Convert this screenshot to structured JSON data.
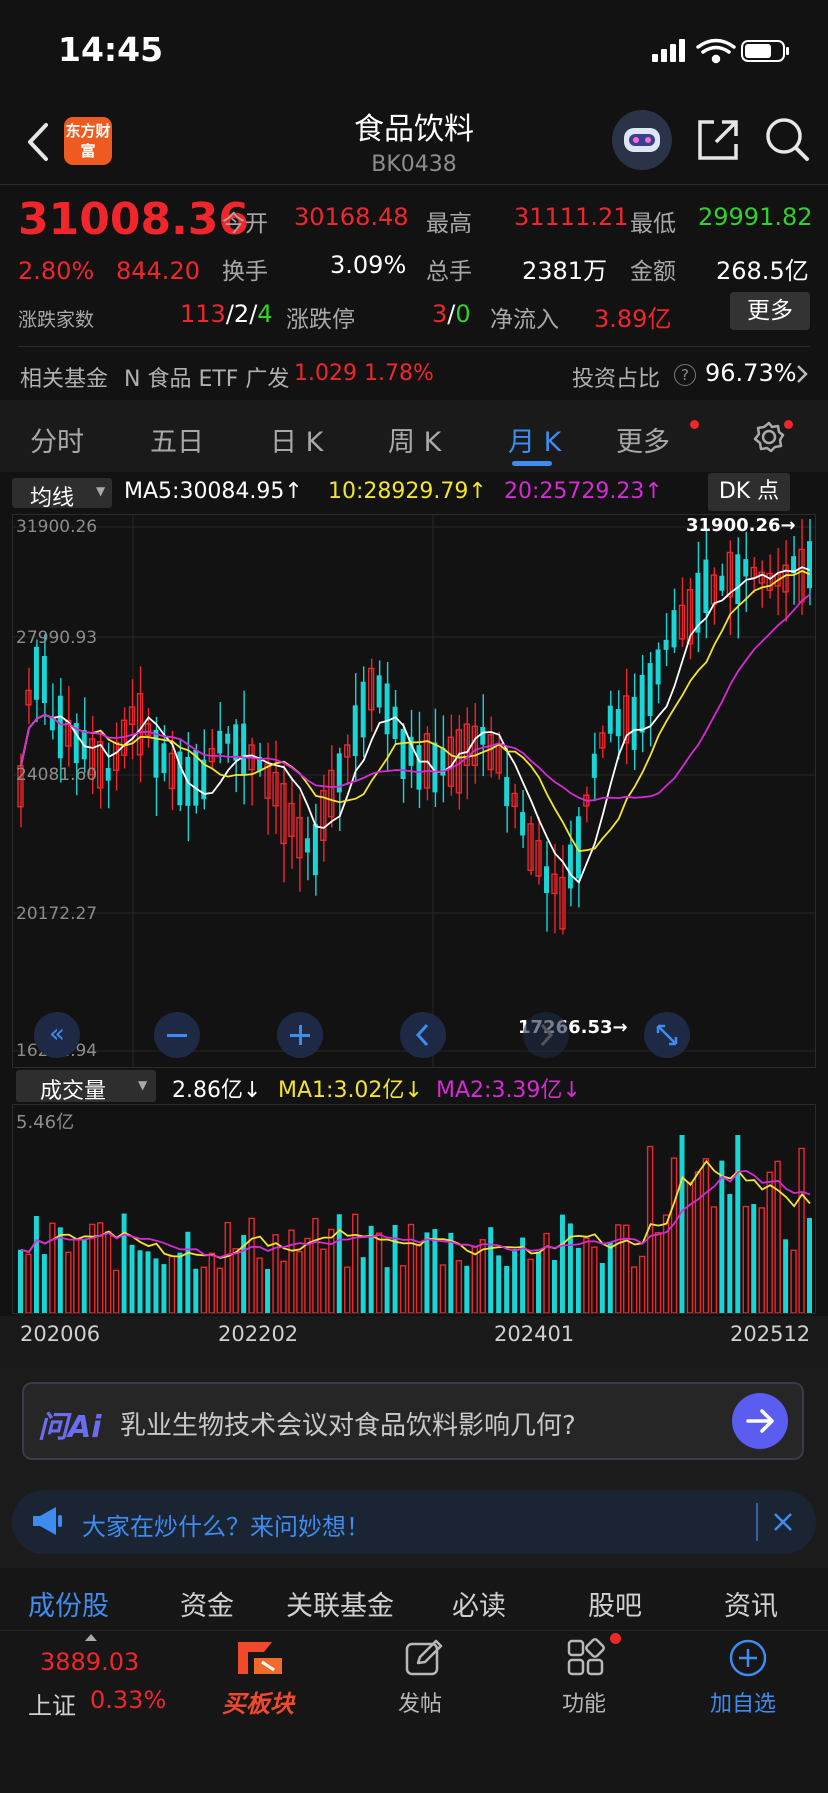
{
  "status_bar": {
    "time": "14:45"
  },
  "header": {
    "title": "食品饮料",
    "code": "BK0438",
    "logo_text": "东方财富"
  },
  "quote": {
    "price": "31008.36",
    "change_pct": "2.80%",
    "change": "844.20",
    "open_label": "今开",
    "open": "30168.48",
    "high_label": "最高",
    "high": "31111.21",
    "low_label": "最低",
    "low": "29991.82",
    "turnover_label": "换手",
    "turnover": "3.09%",
    "volume_label": "总手",
    "volume": "2381万",
    "amount_label": "金额",
    "amount": "268.5亿",
    "updown_label": "涨跌家数",
    "up": "113",
    "flat": "2",
    "down": "4",
    "limit_label": "涨跌停",
    "limit_up": "3",
    "limit_down": "0",
    "inflow_label": "净流入",
    "inflow": "3.89亿",
    "more_label": "更多"
  },
  "fund_row": {
    "label": "相关基金",
    "fund_name": "N 食品 ETF 广发",
    "fund_price": "1.029",
    "fund_pct": "1.78%",
    "ratio_label": "投资占比",
    "ratio_value": "96.73%"
  },
  "tabs": [
    "分时",
    "五日",
    "日 K",
    "周 K",
    "月 K",
    "更多"
  ],
  "active_tab": 4,
  "ma_bar": {
    "selector": "均线",
    "ma5": "MA5:30084.95",
    "ma10": "10:28929.79",
    "ma20": "20:25729.23",
    "dk": "DK 点"
  },
  "price_axis": [
    "31900.26",
    "27990.93",
    "24081.60",
    "20172.27",
    "16262.94"
  ],
  "annotations": {
    "max": "31900.26",
    "min": "17266.53"
  },
  "volume_bar": {
    "selector": "成交量",
    "vol": "2.86亿",
    "ma1": "MA1:3.02亿",
    "ma2": "MA2:3.39亿",
    "axis_max": "5.46亿"
  },
  "date_axis": [
    "202006",
    "202202",
    "202401",
    "202512"
  ],
  "ai_box": {
    "brand": "问Ai",
    "question": "乳业生物技术会议对食品饮料影响几何?"
  },
  "banner": {
    "text": "大家在炒什么？来问妙想！"
  },
  "bottom_tabs": [
    "成份股",
    "资金",
    "关联基金",
    "必读",
    "股吧",
    "资讯"
  ],
  "bottom_nav": {
    "index_value": "3889.03",
    "index_name": "上证",
    "index_pct": "0.33%",
    "buy_label": "买板块",
    "post_label": "发帖",
    "func_label": "功能",
    "add_label": "加自选"
  },
  "colors": {
    "up": "#f0262c",
    "down": "#19d6d6",
    "ma5": "#ffffff",
    "ma10": "#f2e430",
    "ma20": "#d62ad6",
    "accent": "#3f8cf0"
  },
  "chart_data": {
    "type": "candlestick",
    "period": "monthly",
    "price_range": [
      16262.94,
      31900.26
    ],
    "max_label": "31900.26",
    "min_label": "17266.53",
    "x_labels": [
      "202006",
      "202202",
      "202401",
      "202512"
    ],
    "series": [
      {
        "name": "MA5",
        "value": "30084.95"
      },
      {
        "name": "10",
        "value": "28929.79"
      },
      {
        "name": "20",
        "value": "25729.23"
      }
    ],
    "volume": {
      "max": "5.46亿",
      "last": "2.86亿",
      "ma1": "3.02亿",
      "ma2": "3.39亿"
    }
  }
}
